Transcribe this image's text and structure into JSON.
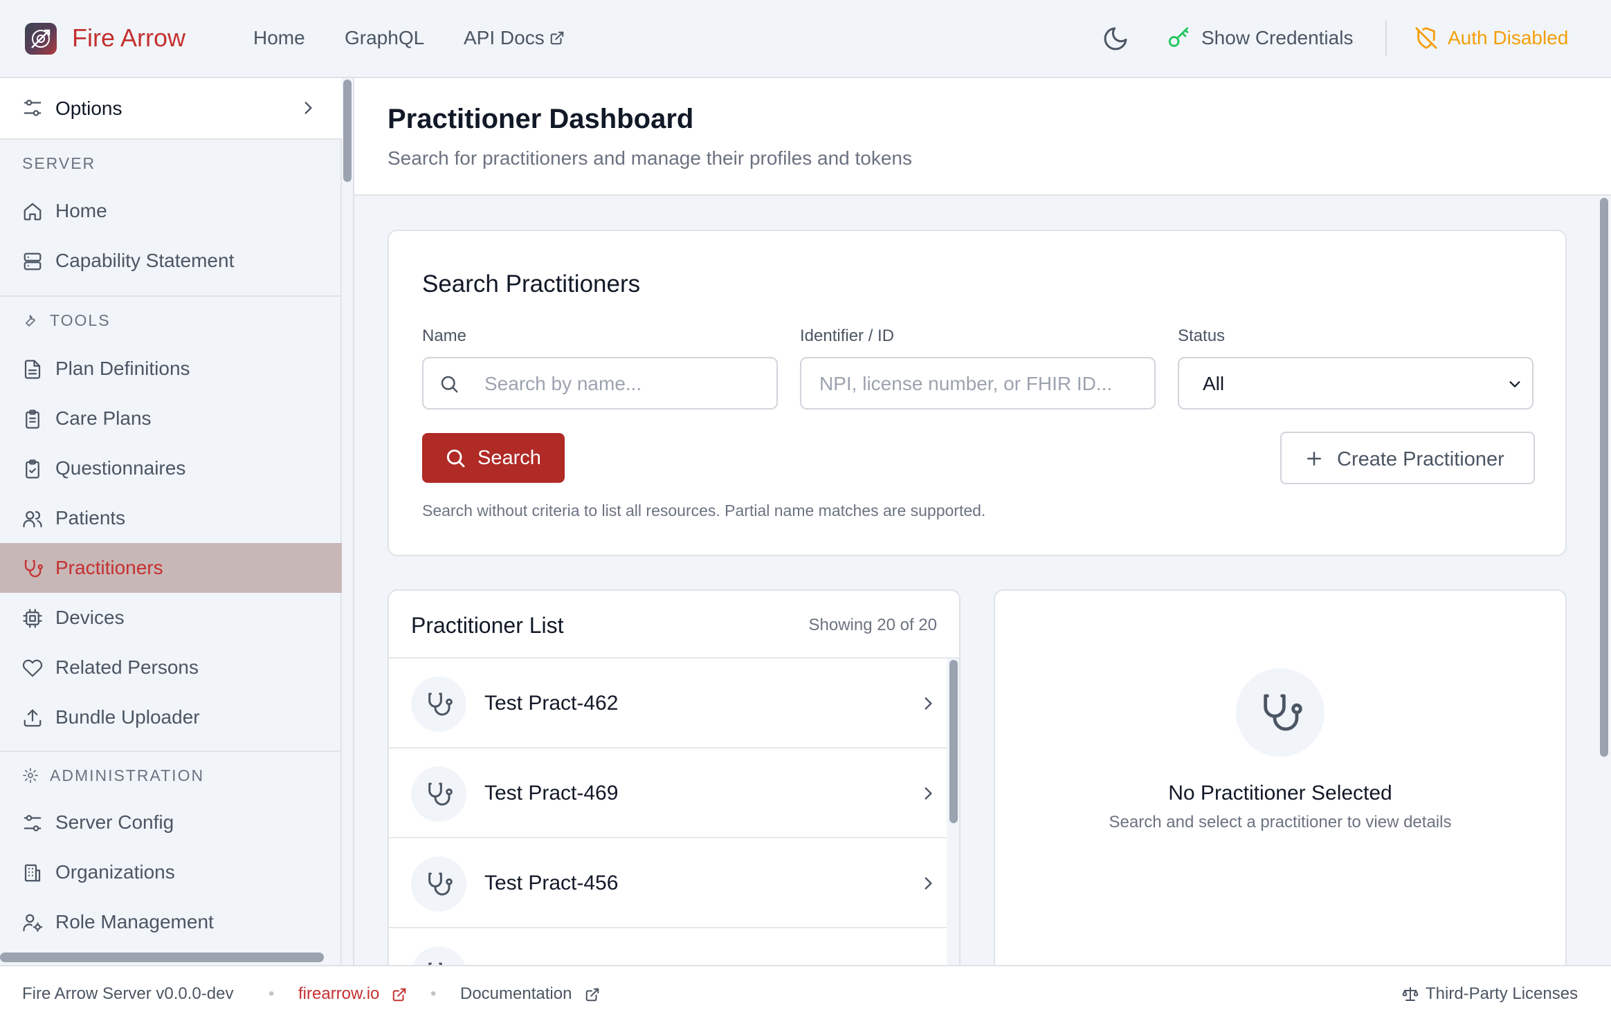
{
  "app": {
    "brand": "Fire Arrow",
    "nav": {
      "home": "Home",
      "graphql": "GraphQL",
      "api_docs": "API Docs"
    },
    "show_credentials": "Show Credentials",
    "auth_status": "Auth Disabled"
  },
  "sidebar": {
    "options_label": "Options",
    "sections": {
      "server": "SERVER",
      "tools": "TOOLS",
      "administration": "ADMINISTRATION"
    },
    "server_items": [
      "Home",
      "Capability Statement"
    ],
    "tools_items": [
      "Plan Definitions",
      "Care Plans",
      "Questionnaires",
      "Patients",
      "Practitioners",
      "Devices",
      "Related Persons",
      "Bundle Uploader"
    ],
    "admin_items": [
      "Server Config",
      "Organizations",
      "Role Management"
    ],
    "active_item": "Practitioners"
  },
  "header": {
    "title": "Practitioner Dashboard",
    "subtitle": "Search for practitioners and manage their profiles and tokens"
  },
  "search": {
    "title": "Search Practitioners",
    "name_label": "Name",
    "name_placeholder": "Search by name...",
    "id_label": "Identifier / ID",
    "id_placeholder": "NPI, license number, or FHIR ID...",
    "status_label": "Status",
    "status_value": "All",
    "search_button": "Search",
    "create_button": "Create Practitioner",
    "hint": "Search without criteria to list all resources. Partial name matches are supported."
  },
  "list": {
    "title": "Practitioner List",
    "count": "Showing 20 of 20",
    "rows": [
      "Test Pract-462",
      "Test Pract-469",
      "Test Pract-456"
    ]
  },
  "detail": {
    "empty_title": "No Practitioner Selected",
    "empty_subtitle": "Search and select a practitioner to view details"
  },
  "footer": {
    "version": "Fire Arrow Server v0.0.0-dev",
    "site_link": "firearrow.io",
    "docs_link": "Documentation",
    "licenses_link": "Third-Party Licenses"
  },
  "colors": {
    "brand": "#c53030",
    "primary_button": "#b02a26",
    "auth_warning": "#f59e0b",
    "active_nav_bg": "#c8b7b7",
    "key_icon": "#22c55e"
  },
  "icons": [
    "logo-icon",
    "external-link-icon",
    "moon-icon",
    "key-icon",
    "shield-off-icon",
    "sliders-icon",
    "chevron-right-icon",
    "home-icon",
    "server-icon",
    "wrench-icon",
    "file-text-icon",
    "clipboard-list-icon",
    "clipboard-check-icon",
    "users-icon",
    "stethoscope-icon",
    "cpu-icon",
    "heart-icon",
    "upload-icon",
    "gear-icon",
    "building-icon",
    "user-cog-icon",
    "search-icon",
    "chevron-down-icon",
    "plus-icon",
    "scale-icon"
  ]
}
